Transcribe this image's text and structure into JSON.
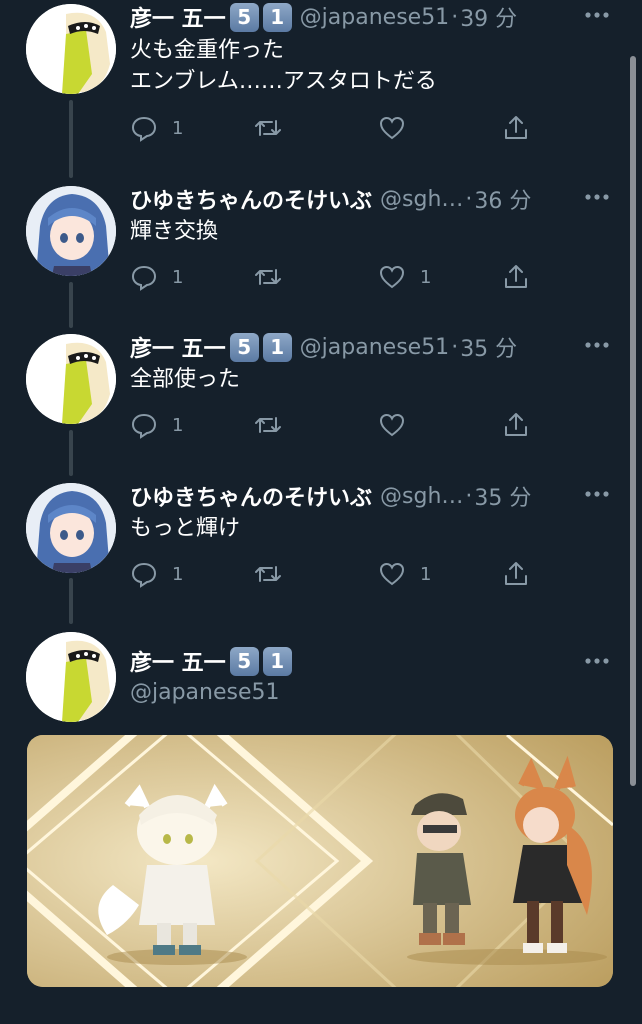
{
  "tweets": [
    {
      "name": "彦一 五一",
      "badges": [
        "5",
        "1"
      ],
      "handle": "@japanese51",
      "dot": "·",
      "time": "39 分",
      "text": "火も金重作った\nエンブレム……アスタロトだる",
      "reply_count": "1",
      "like_count": ""
    },
    {
      "name": "ひゆきちゃんのそけいぶ",
      "badges": [],
      "handle": "@sgh…",
      "dot": "·",
      "time": "36 分",
      "text": "輝き交換",
      "reply_count": "1",
      "like_count": "1"
    },
    {
      "name": "彦一 五一",
      "badges": [
        "5",
        "1"
      ],
      "handle": "@japanese51",
      "dot": "·",
      "time": "35 分",
      "text": "全部使った",
      "reply_count": "1",
      "like_count": ""
    },
    {
      "name": "ひゆきちゃんのそけいぶ",
      "badges": [],
      "handle": "@sgh…",
      "dot": "·",
      "time": "35 分",
      "text": "もっと輝け",
      "reply_count": "1",
      "like_count": "1"
    }
  ],
  "focused_tweet": {
    "name": "彦一 五一",
    "badges": [
      "5",
      "1"
    ],
    "handle": "@japanese51"
  },
  "icons": {
    "reply": "reply-icon",
    "retweet": "retweet-icon",
    "like": "like-icon",
    "share": "share-icon",
    "more": "more-icon"
  },
  "colors": {
    "background": "#15202b",
    "secondary_text": "#8899a6",
    "thread_line": "#38444d"
  }
}
